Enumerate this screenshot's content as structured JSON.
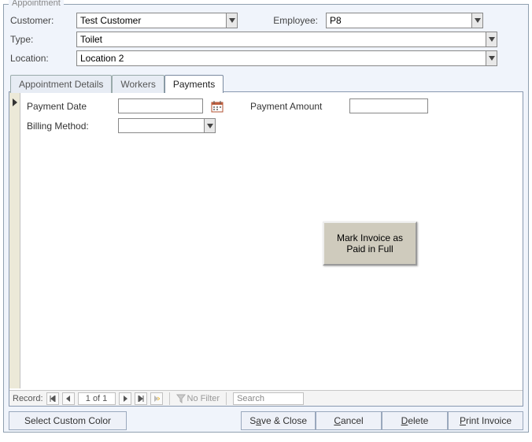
{
  "group_title": "Appointment",
  "header": {
    "customer_label": "Customer:",
    "customer_value": "Test Customer",
    "employee_label": "Employee:",
    "employee_value": "P8",
    "type_label": "Type:",
    "type_value": "Toilet",
    "location_label": "Location:",
    "location_value": "Location 2"
  },
  "tabs": {
    "t0": "Appointment Details",
    "t1": "Workers",
    "t2": "Payments",
    "active_index": 2
  },
  "payments": {
    "payment_date_label": "Payment Date",
    "payment_date_value": "",
    "payment_amount_label": "Payment Amount",
    "payment_amount_value": "",
    "billing_method_label": "Billing Method:",
    "billing_method_value": "",
    "mark_paid_label": "Mark Invoice as Paid in Full"
  },
  "recordnav": {
    "label": "Record:",
    "position": "1 of 1",
    "no_filter": "No Filter",
    "search_placeholder": "Search"
  },
  "footer": {
    "select_color": "Select Custom Color",
    "save_close_pre": "S",
    "save_close_u": "a",
    "save_close_post": "ve & Close",
    "cancel_u": "C",
    "cancel_post": "ancel",
    "delete_u": "D",
    "delete_post": "elete",
    "print_u": "P",
    "print_post": "rint Invoice"
  }
}
